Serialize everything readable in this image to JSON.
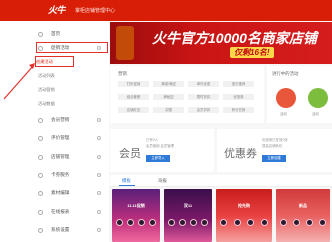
{
  "header": {
    "logo": "火牛",
    "system_title": "掌柜店铺管理中心"
  },
  "sidebar": {
    "items": [
      {
        "label": "首页"
      },
      {
        "label": "促销活动"
      },
      {
        "label": "会员营销"
      },
      {
        "label": "评价管理"
      },
      {
        "label": "店铺管理"
      },
      {
        "label": "卡券服务"
      },
      {
        "label": "素材编辑"
      },
      {
        "label": "在线报表"
      },
      {
        "label": "系统设置"
      }
    ],
    "sub_items": [
      {
        "label": "创建活动"
      },
      {
        "label": "活动列表"
      },
      {
        "label": "活动营销"
      },
      {
        "label": "活动数据"
      }
    ]
  },
  "banner": {
    "title": "火牛官方10000名商家店铺",
    "subtitle": "仅剩16名!"
  },
  "func_card": {
    "header": "营销",
    "chips": [
      "打折促销",
      "满减/满送",
      "单件优惠",
      "宝贝推荐",
      "组合套餐",
      "满就送",
      "限时折扣",
      "优惠券",
      "店铺红包",
      "买赠",
      "会员折扣",
      "积分兑换"
    ]
  },
  "progress_card": {
    "header": "进行中的活动",
    "items": [
      {
        "label": "活动"
      },
      {
        "label": "活动"
      }
    ]
  },
  "member_card": {
    "title": "会员",
    "desc1": "已有0人",
    "desc2": "会员营销 会员管理",
    "button": "立即导入"
  },
  "coupon_card": {
    "title": "优惠券",
    "desc1": "优惠券已发放0张",
    "desc2": "提高店铺转化",
    "button": "立即创建"
  },
  "tabs": [
    {
      "label": "模板"
    },
    {
      "label": "海报"
    }
  ],
  "templates": [
    {
      "caption": "11.11促销"
    },
    {
      "caption": "双11"
    },
    {
      "caption": "抢先购"
    },
    {
      "caption": "新品"
    }
  ],
  "colors": {
    "brand_red": "#d81e06",
    "accent_blue": "#2e7ad8",
    "highlight_border": "#e0322b"
  }
}
